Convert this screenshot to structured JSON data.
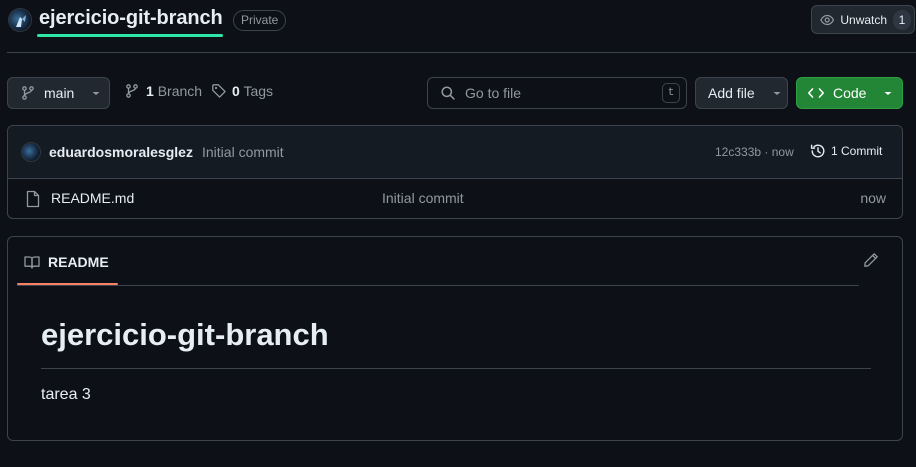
{
  "repo": {
    "name": "ejercicio-git-branch",
    "visibility": "Private",
    "watch_label": "Unwatch",
    "watch_count": "1"
  },
  "toolbar": {
    "branch": "main",
    "branch_count": "1",
    "branch_label": "Branch",
    "tag_count": "0",
    "tag_label": "Tags",
    "search_placeholder": "Go to file",
    "search_shortcut": "t",
    "add_file_label": "Add file",
    "code_label": "Code"
  },
  "commit": {
    "author": "eduardosmoralesglez",
    "message": "Initial commit",
    "hash": "12c333b",
    "separator": "·",
    "time": "now",
    "count_label": "1 Commit"
  },
  "files": [
    {
      "name": "README.md",
      "commit_message": "Initial commit",
      "time": "now",
      "icon": "file-icon"
    }
  ],
  "readme": {
    "tab_label": "README",
    "title": "ejercicio-git-branch",
    "body": "tarea 3"
  },
  "colors": {
    "background": "#0d1117",
    "accent_underline": "#2ee6a6",
    "code_button": "#238636",
    "readme_tab_underline": "#f78166"
  }
}
